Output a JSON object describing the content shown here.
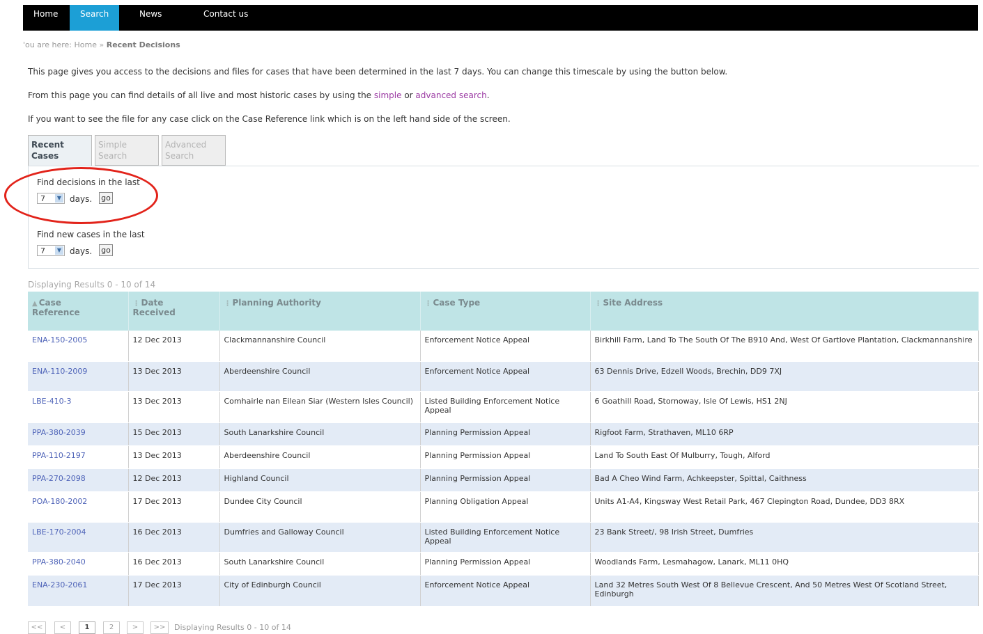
{
  "nav": {
    "items": [
      "Home",
      "Search",
      "News",
      "Contact us"
    ],
    "active_index": 1
  },
  "breadcrumb": {
    "prefix": "'ou are here:",
    "home": "Home",
    "separator": "»",
    "current": "Recent Decisions"
  },
  "intro": {
    "line1": "This page gives you access to the decisions and files for cases that have been determined in the last 7 days. You can change this timescale by using the button below.",
    "line2_pre": "From this page you can find details of all live and most historic cases by using the ",
    "line2_link1": "simple",
    "line2_mid": " or ",
    "line2_link2": "advanced search",
    "line2_post": ".",
    "line3": "If you want to see the file for any case click on the Case Reference link which is on the left hand side of the screen."
  },
  "tabs": [
    {
      "line1": "Recent",
      "line2": "Cases"
    },
    {
      "line1": "Simple",
      "line2": "Search"
    },
    {
      "line1": "Advanced",
      "line2": "Search"
    }
  ],
  "filters": {
    "decisions_label": "Find decisions in the last",
    "decisions_value": "7",
    "new_cases_label": "Find new cases in the last",
    "new_cases_value": "7",
    "days_label": "days.",
    "go_label": "go"
  },
  "results_count": "Displaying Results 0 - 10 of 14",
  "table": {
    "headers": [
      {
        "line1": "Case",
        "line2": "Reference",
        "marker": "▲"
      },
      {
        "line1": "Date",
        "line2": "Received",
        "marker": "⋮"
      },
      {
        "line1": "Planning Authority",
        "line2": "",
        "marker": "⋮"
      },
      {
        "line1": "Case Type",
        "line2": "",
        "marker": "⋮"
      },
      {
        "line1": "Site Address",
        "line2": "",
        "marker": "⋮"
      }
    ],
    "rows": [
      {
        "ref": "ENA-150-2005",
        "date": "12 Dec 2013",
        "authority": "Clackmannanshire Council",
        "type": "Enforcement Notice Appeal",
        "address": "Birkhill Farm, Land To The South Of The B910 And, West Of Gartlove Plantation, Clackmannanshire"
      },
      {
        "ref": "ENA-110-2009",
        "date": "13 Dec 2013",
        "authority": "Aberdeenshire Council",
        "type": "Enforcement Notice Appeal",
        "address": "63 Dennis Drive, Edzell Woods, Brechin, DD9 7XJ"
      },
      {
        "ref": "LBE-410-3",
        "date": "13 Dec 2013",
        "authority": "Comhairle nan Eilean Siar (Western Isles Council)",
        "type": "Listed Building Enforcement Notice Appeal",
        "address": "6 Goathill Road, Stornoway, Isle Of Lewis, HS1 2NJ"
      },
      {
        "ref": "PPA-380-2039",
        "date": "15 Dec 2013",
        "authority": "South Lanarkshire Council",
        "type": "Planning Permission Appeal",
        "address": "Rigfoot Farm, Strathaven, ML10 6RP"
      },
      {
        "ref": "PPA-110-2197",
        "date": "13 Dec 2013",
        "authority": "Aberdeenshire Council",
        "type": "Planning Permission Appeal",
        "address": "Land To South East Of Mulburry, Tough, Alford"
      },
      {
        "ref": "PPA-270-2098",
        "date": "12 Dec 2013",
        "authority": "Highland Council",
        "type": "Planning Permission Appeal",
        "address": "Bad A Cheo Wind Farm, Achkeepster, Spittal, Caithness"
      },
      {
        "ref": "POA-180-2002",
        "date": "17 Dec 2013",
        "authority": "Dundee City Council",
        "type": "Planning Obligation Appeal",
        "address": "Units A1-A4, Kingsway West Retail Park, 467 Clepington Road, Dundee, DD3 8RX"
      },
      {
        "ref": "LBE-170-2004",
        "date": "16 Dec 2013",
        "authority": "Dumfries and Galloway Council",
        "type": "Listed Building Enforcement Notice Appeal",
        "address": "23 Bank Street/, 98 Irish Street, Dumfries"
      },
      {
        "ref": "PPA-380-2040",
        "date": "16 Dec 2013",
        "authority": "South Lanarkshire Council",
        "type": "Planning Permission Appeal",
        "address": "Woodlands Farm, Lesmahagow, Lanark, ML11 0HQ"
      },
      {
        "ref": "ENA-230-2061",
        "date": "17 Dec 2013",
        "authority": "City of Edinburgh Council",
        "type": "Enforcement Notice Appeal",
        "address": "Land 32 Metres South West Of 8 Bellevue Crescent, And 50 Metres West Of Scotland Street, Edinburgh"
      }
    ]
  },
  "pager": {
    "first": "<<",
    "prev": "<",
    "page1": "1",
    "page2": "2",
    "next": ">",
    "last": ">>",
    "text": "Displaying Results 0 - 10 of 14"
  }
}
